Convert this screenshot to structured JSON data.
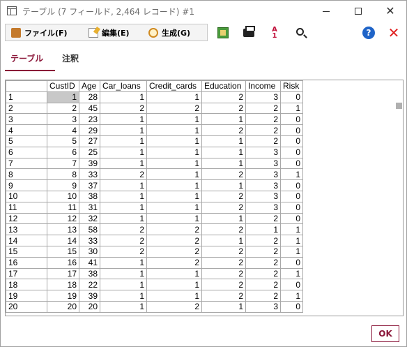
{
  "window": {
    "title": "テーブル (7 フィールド, 2,464 レコード) #1",
    "controls": {
      "minimize": "",
      "maximize": "",
      "close": "✕"
    }
  },
  "menu": {
    "file": "ファイル(F)",
    "edit": "編集(E)",
    "generate": "生成(G)"
  },
  "toolbar": {
    "export_icon": "export-icon",
    "print_icon": "print-icon",
    "sort_icon": "sort-icon",
    "sort_glyph_top": "A",
    "sort_glyph_bottom": "1",
    "find_icon": "search-icon",
    "help_glyph": "?",
    "close_glyph": "✕"
  },
  "tabs": [
    {
      "label": "テーブル",
      "active": true
    },
    {
      "label": "注釈",
      "active": false
    }
  ],
  "table": {
    "columns": [
      "",
      "CustID",
      "Age",
      "Car_loans",
      "Credit_cards",
      "Education",
      "Income",
      "Risk"
    ],
    "rows": [
      [
        "1",
        "1",
        "28",
        "1",
        "1",
        "2",
        "3",
        "0"
      ],
      [
        "2",
        "2",
        "45",
        "2",
        "2",
        "2",
        "2",
        "1"
      ],
      [
        "3",
        "3",
        "23",
        "1",
        "1",
        "1",
        "2",
        "0"
      ],
      [
        "4",
        "4",
        "29",
        "1",
        "1",
        "2",
        "2",
        "0"
      ],
      [
        "5",
        "5",
        "27",
        "1",
        "1",
        "1",
        "2",
        "0"
      ],
      [
        "6",
        "6",
        "25",
        "1",
        "1",
        "1",
        "3",
        "0"
      ],
      [
        "7",
        "7",
        "39",
        "1",
        "1",
        "1",
        "3",
        "0"
      ],
      [
        "8",
        "8",
        "33",
        "2",
        "1",
        "2",
        "3",
        "1"
      ],
      [
        "9",
        "9",
        "37",
        "1",
        "1",
        "1",
        "3",
        "0"
      ],
      [
        "10",
        "10",
        "38",
        "1",
        "1",
        "2",
        "3",
        "0"
      ],
      [
        "11",
        "11",
        "31",
        "1",
        "1",
        "2",
        "3",
        "0"
      ],
      [
        "12",
        "12",
        "32",
        "1",
        "1",
        "1",
        "2",
        "0"
      ],
      [
        "13",
        "13",
        "58",
        "2",
        "2",
        "2",
        "1",
        "1"
      ],
      [
        "14",
        "14",
        "33",
        "2",
        "2",
        "1",
        "2",
        "1"
      ],
      [
        "15",
        "15",
        "30",
        "2",
        "2",
        "2",
        "2",
        "1"
      ],
      [
        "16",
        "16",
        "41",
        "1",
        "2",
        "2",
        "2",
        "0"
      ],
      [
        "17",
        "17",
        "38",
        "1",
        "1",
        "2",
        "2",
        "1"
      ],
      [
        "18",
        "18",
        "22",
        "1",
        "1",
        "2",
        "2",
        "0"
      ],
      [
        "19",
        "19",
        "39",
        "1",
        "1",
        "2",
        "2",
        "1"
      ],
      [
        "20",
        "20",
        "20",
        "1",
        "2",
        "1",
        "3",
        "0"
      ]
    ],
    "selected_cell": {
      "row": 0,
      "col": 1
    }
  },
  "footer": {
    "ok_label": "OK"
  },
  "colors": {
    "accent": "#8a1538",
    "help_blue": "#1f64c8",
    "close_red": "#e02020",
    "selection_gray": "#c8c8c8"
  }
}
